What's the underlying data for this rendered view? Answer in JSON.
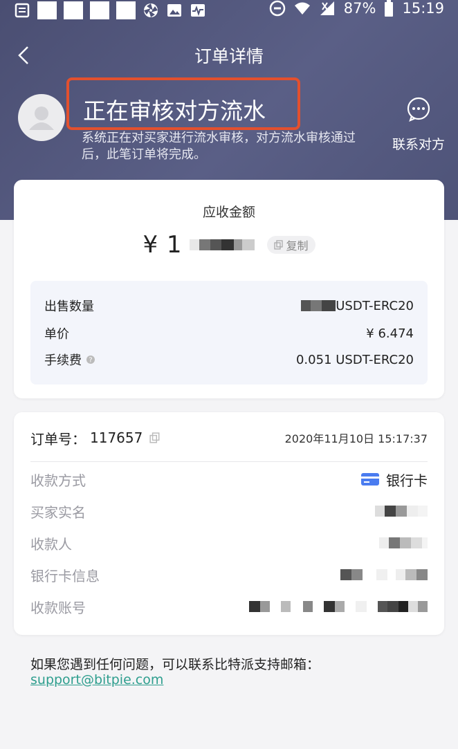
{
  "status_bar": {
    "battery": "87%",
    "time": "15:19"
  },
  "nav": {
    "title": "订单详情"
  },
  "order_status": {
    "title": "正在审核对方流水",
    "description": "系统正在对买家进行流水审核，对方流水审核通过后，此笔订单将完成。",
    "contact_label": "联系对方"
  },
  "amount": {
    "label": "应收金额",
    "value": "¥ 1",
    "copy_label": "复制"
  },
  "trade_info": {
    "sell_qty_label": "出售数量",
    "sell_qty_value": "USDT-ERC20",
    "price_label": "单价",
    "price_value": "¥ 6.474",
    "fee_label": "手续费",
    "fee_value": "0.051 USDT-ERC20"
  },
  "order": {
    "number_label": "订单号：",
    "number": "117657",
    "date": "2020年11月10日 15:17:37"
  },
  "payment": {
    "method_label": "收款方式",
    "method_value": "银行卡",
    "buyer_name_label": "买家实名",
    "payee_label": "收款人",
    "bank_info_label": "银行卡信息",
    "account_label": "收款账号"
  },
  "footer": {
    "help_text": "如果您遇到任何问题，可以联系比特派支持邮箱：",
    "email": "support@bitpie.com"
  },
  "colors": {
    "header": "#4e5378",
    "highlight_box": "#e3502e",
    "link": "#2e9e8e",
    "bank_icon": "#4a7cf0"
  }
}
